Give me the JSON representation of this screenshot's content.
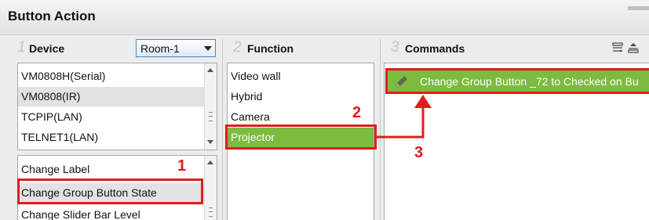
{
  "header": {
    "title": "Button Action"
  },
  "columns": {
    "device": {
      "num": "1",
      "label": "Device"
    },
    "function": {
      "num": "2",
      "label": "Function"
    },
    "commands": {
      "num": "3",
      "label": "Commands"
    }
  },
  "room_select": {
    "value": "Room-1"
  },
  "device_list": [
    "VM0808H(Serial)",
    "VM0808(IR)",
    "TCPIP(LAN)",
    "TELNET1(LAN)"
  ],
  "action_list": [
    "Change Label",
    "Change Group Button State",
    "Change Slider Bar Level"
  ],
  "function_list": [
    "Video wall",
    "Hybrid",
    "Camera",
    "Projector"
  ],
  "command_item": "Change Group Button _72 to Checked on Bu",
  "steps": [
    "1",
    "2",
    "3"
  ],
  "colors": {
    "accent_green": "#7cbb3f",
    "highlight_red": "#e31b1b",
    "select_border": "#4d87c8"
  }
}
